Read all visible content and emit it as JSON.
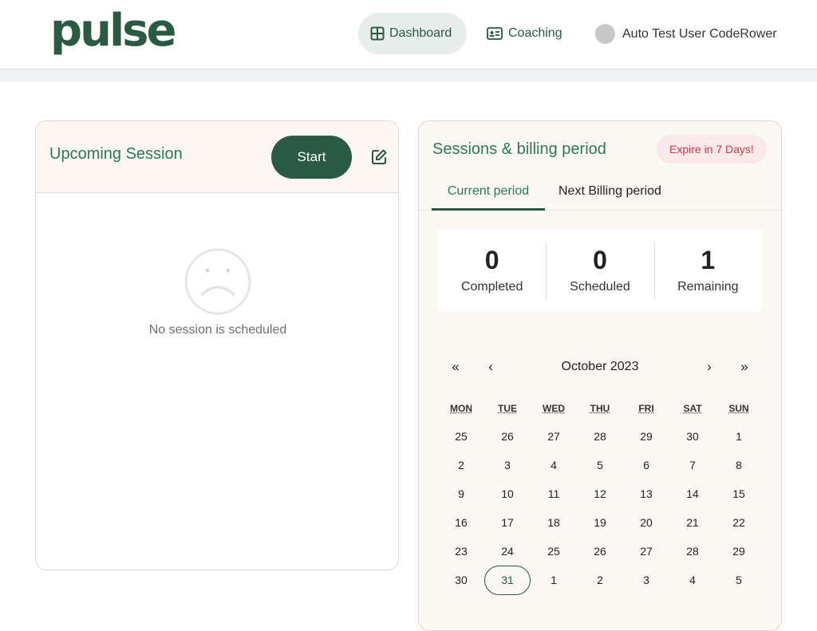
{
  "header": {
    "logo": "pulse",
    "nav": [
      {
        "label": "Dashboard",
        "icon": "grid-icon",
        "active": true
      },
      {
        "label": "Coaching",
        "icon": "id-card-icon",
        "active": false
      }
    ],
    "user_name": "Auto Test User CodeRower"
  },
  "upcoming": {
    "title": "Upcoming Session",
    "start_label": "Start",
    "empty_text": "No session is scheduled"
  },
  "sessions": {
    "title": "Sessions & billing period",
    "expire_badge": "Expire in 7 Days!",
    "tabs": [
      {
        "label": "Current period",
        "active": true
      },
      {
        "label": "Next Billing period",
        "active": false
      }
    ],
    "stats": [
      {
        "value": "0",
        "label": "Completed"
      },
      {
        "value": "0",
        "label": "Scheduled"
      },
      {
        "value": "1",
        "label": "Remaining"
      }
    ]
  },
  "calendar": {
    "month": "October 2023",
    "nav": {
      "prev_year": "«",
      "prev": "‹",
      "next": "›",
      "next_year": "»"
    },
    "weekdays": [
      "MON",
      "TUE",
      "WED",
      "THU",
      "FRI",
      "SAT",
      "SUN"
    ],
    "days": [
      "25",
      "26",
      "27",
      "28",
      "29",
      "30",
      "1",
      "2",
      "3",
      "4",
      "5",
      "6",
      "7",
      "8",
      "9",
      "10",
      "11",
      "12",
      "13",
      "14",
      "15",
      "16",
      "17",
      "18",
      "19",
      "20",
      "21",
      "22",
      "23",
      "24",
      "25",
      "26",
      "27",
      "28",
      "29",
      "30",
      "31",
      "1",
      "2",
      "3",
      "4",
      "5"
    ],
    "today_index": 36
  },
  "colors": {
    "brand": "#2a5a44",
    "accent_text": "#2a7a57",
    "badge_bg": "#fbe9e9",
    "badge_text": "#d33a4a"
  }
}
